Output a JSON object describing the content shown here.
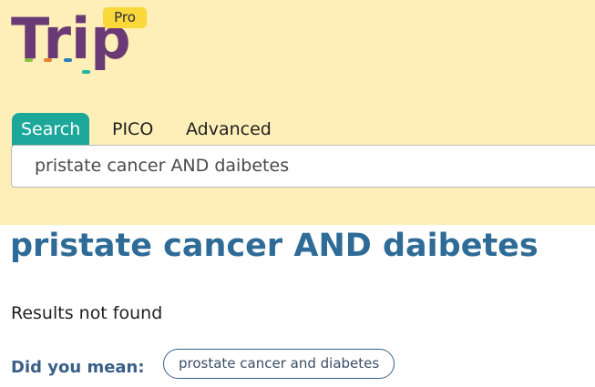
{
  "header": {
    "logo_text": "Trip",
    "badge": "Pro",
    "logo_colors": [
      "#6a3a76",
      "#8ac43f",
      "#e7872b",
      "#2a7fbf",
      "#23b3a4"
    ]
  },
  "tabs": [
    {
      "label": "Search",
      "active": true
    },
    {
      "label": "PICO",
      "active": false
    },
    {
      "label": "Advanced",
      "active": false
    }
  ],
  "search": {
    "value": "pristate cancer AND daibetes"
  },
  "main": {
    "title": "pristate cancer AND daibetes",
    "status": "Results not found",
    "did_you_mean_label": "Did you mean:",
    "suggestion": "prostate cancer and diabetes"
  },
  "colors": {
    "header_bg": "#feefb8",
    "active_tab": "#1ba89a",
    "title": "#2f6b97",
    "badge": "#fbd83a"
  }
}
